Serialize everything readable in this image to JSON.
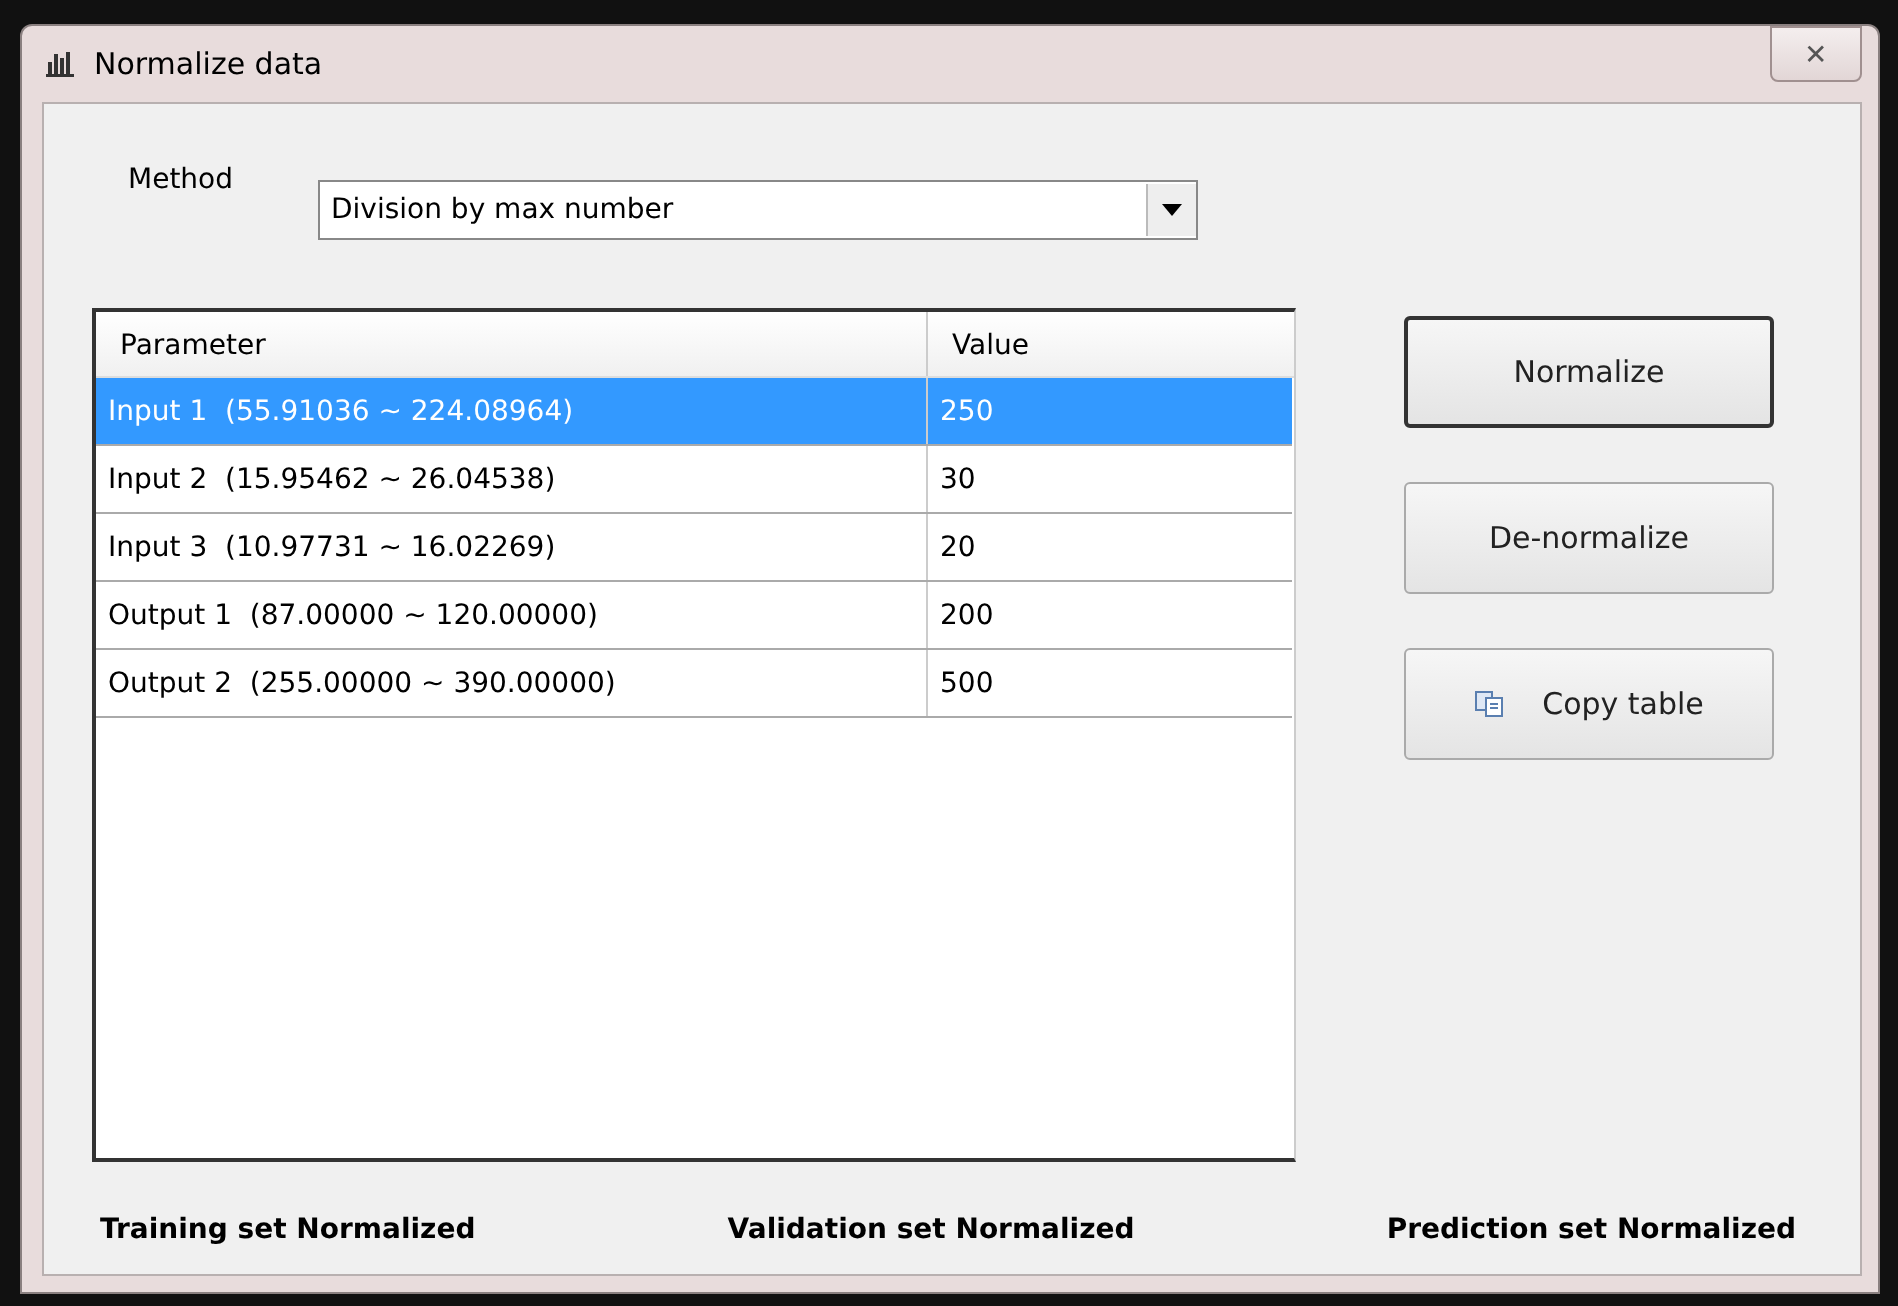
{
  "window": {
    "title": "Normalize data",
    "close": "✕"
  },
  "method": {
    "label": "Method",
    "value": "Division by max number"
  },
  "table": {
    "columns": [
      "Parameter",
      "Value"
    ],
    "rows": [
      {
        "parameter": "Input 1  (55.91036 ~ 224.08964)",
        "value": "250",
        "selected": true
      },
      {
        "parameter": "Input 2  (15.95462 ~ 26.04538)",
        "value": "30",
        "selected": false
      },
      {
        "parameter": "Input 3  (10.97731 ~ 16.02269)",
        "value": "20",
        "selected": false
      },
      {
        "parameter": "Output 1  (87.00000 ~ 120.00000)",
        "value": "200",
        "selected": false
      },
      {
        "parameter": "Output 2  (255.00000 ~ 390.00000)",
        "value": "500",
        "selected": false
      }
    ]
  },
  "buttons": [
    {
      "label": "Normalize",
      "kind": "plain",
      "default": true
    },
    {
      "label": "De-normalize",
      "kind": "plain",
      "default": false
    },
    {
      "label": "Copy table",
      "kind": "copy",
      "default": false
    }
  ],
  "status": [
    "Training set Normalized",
    "Validation set Normalized",
    "Prediction set Normalized"
  ]
}
